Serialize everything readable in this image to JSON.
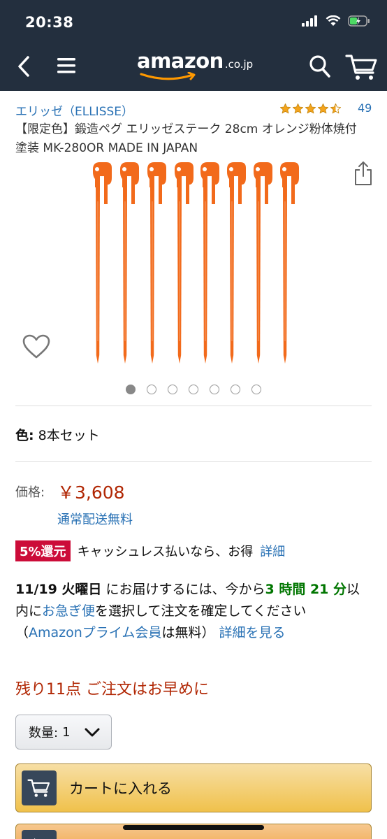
{
  "status_bar": {
    "time": "20:38"
  },
  "header": {
    "logo_word": "amazon",
    "logo_suffix": ".co.jp"
  },
  "product": {
    "brand": "エリッゼ（ELLISSE）",
    "rating": 4.5,
    "rating_count": "49",
    "title": "【限定色】鍛造ペグ エリッゼステーク 28cm オレンジ粉体焼付塗装 MK-280OR MADE IN JAPAN",
    "image_count": 7,
    "active_image": 0
  },
  "variation": {
    "label": "色:",
    "value": "8本セット"
  },
  "price": {
    "label": "価格:",
    "value": "￥3,608",
    "shipping": "通常配送無料"
  },
  "cashback": {
    "badge": "5%還元",
    "text": "キャッシュレス払いなら、お得",
    "link": "詳細"
  },
  "delivery": {
    "date": "11/19 火曜日",
    "t1": "にお届けするには、今から",
    "countdown": "3 時間 21 分",
    "t2": "以内に",
    "express": "お急ぎ便",
    "t3": "を選択して注文を確定してください（",
    "prime": "Amazonプライム会員",
    "t4": "は無料）",
    "details": "詳細を見る"
  },
  "stock": "残り11点 ご注文はお早めに",
  "quantity": {
    "label": "数量:",
    "value": "1"
  },
  "buttons": {
    "add_to_cart": "カートに入れる"
  },
  "colors": {
    "header_bg": "#232f3e",
    "link": "#2a72b5",
    "price": "#b12704",
    "badge": "#cc0c39",
    "green": "#007600",
    "star": "#f4a41c",
    "peg": "#f26a1b"
  }
}
